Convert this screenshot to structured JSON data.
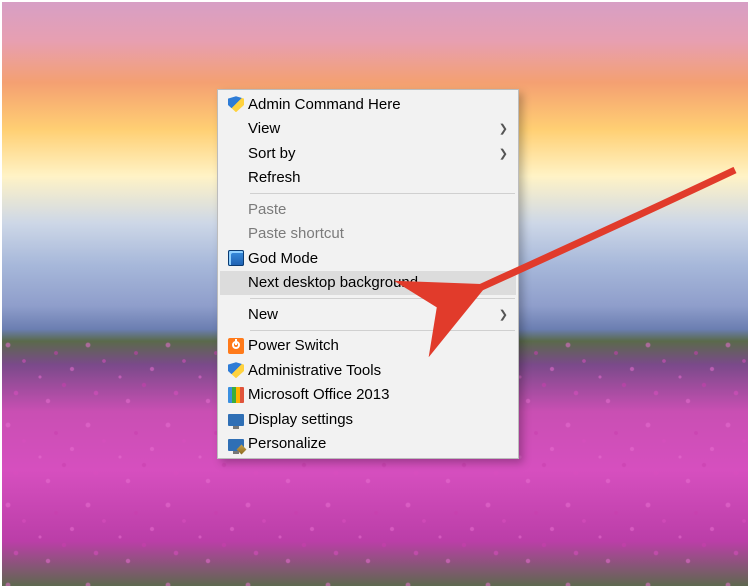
{
  "context_menu": {
    "items": [
      {
        "label": "Admin Command Here",
        "icon": "shield-icon",
        "submenu": false,
        "disabled": false
      },
      {
        "label": "View",
        "icon": null,
        "submenu": true,
        "disabled": false
      },
      {
        "label": "Sort by",
        "icon": null,
        "submenu": true,
        "disabled": false
      },
      {
        "label": "Refresh",
        "icon": null,
        "submenu": false,
        "disabled": false
      },
      {
        "separator": true
      },
      {
        "label": "Paste",
        "icon": null,
        "submenu": false,
        "disabled": true
      },
      {
        "label": "Paste shortcut",
        "icon": null,
        "submenu": false,
        "disabled": true
      },
      {
        "label": "God Mode",
        "icon": "godmode-icon",
        "submenu": false,
        "disabled": false
      },
      {
        "label": "Next desktop background",
        "icon": null,
        "submenu": false,
        "disabled": false,
        "highlight": true
      },
      {
        "separator": true
      },
      {
        "label": "New",
        "icon": null,
        "submenu": true,
        "disabled": false
      },
      {
        "separator": true
      },
      {
        "label": "Power Switch",
        "icon": "power-icon",
        "submenu": false,
        "disabled": false
      },
      {
        "label": "Administrative Tools",
        "icon": "admintools-icon",
        "submenu": false,
        "disabled": false
      },
      {
        "label": "Microsoft Office 2013",
        "icon": "office-icon",
        "submenu": false,
        "disabled": false
      },
      {
        "label": "Display settings",
        "icon": "display-icon",
        "submenu": false,
        "disabled": false
      },
      {
        "label": "Personalize",
        "icon": "personalize-icon",
        "submenu": false,
        "disabled": false
      }
    ],
    "submenu_arrow_glyph": "❯"
  },
  "annotation": {
    "arrow_color": "#e13b2b"
  }
}
